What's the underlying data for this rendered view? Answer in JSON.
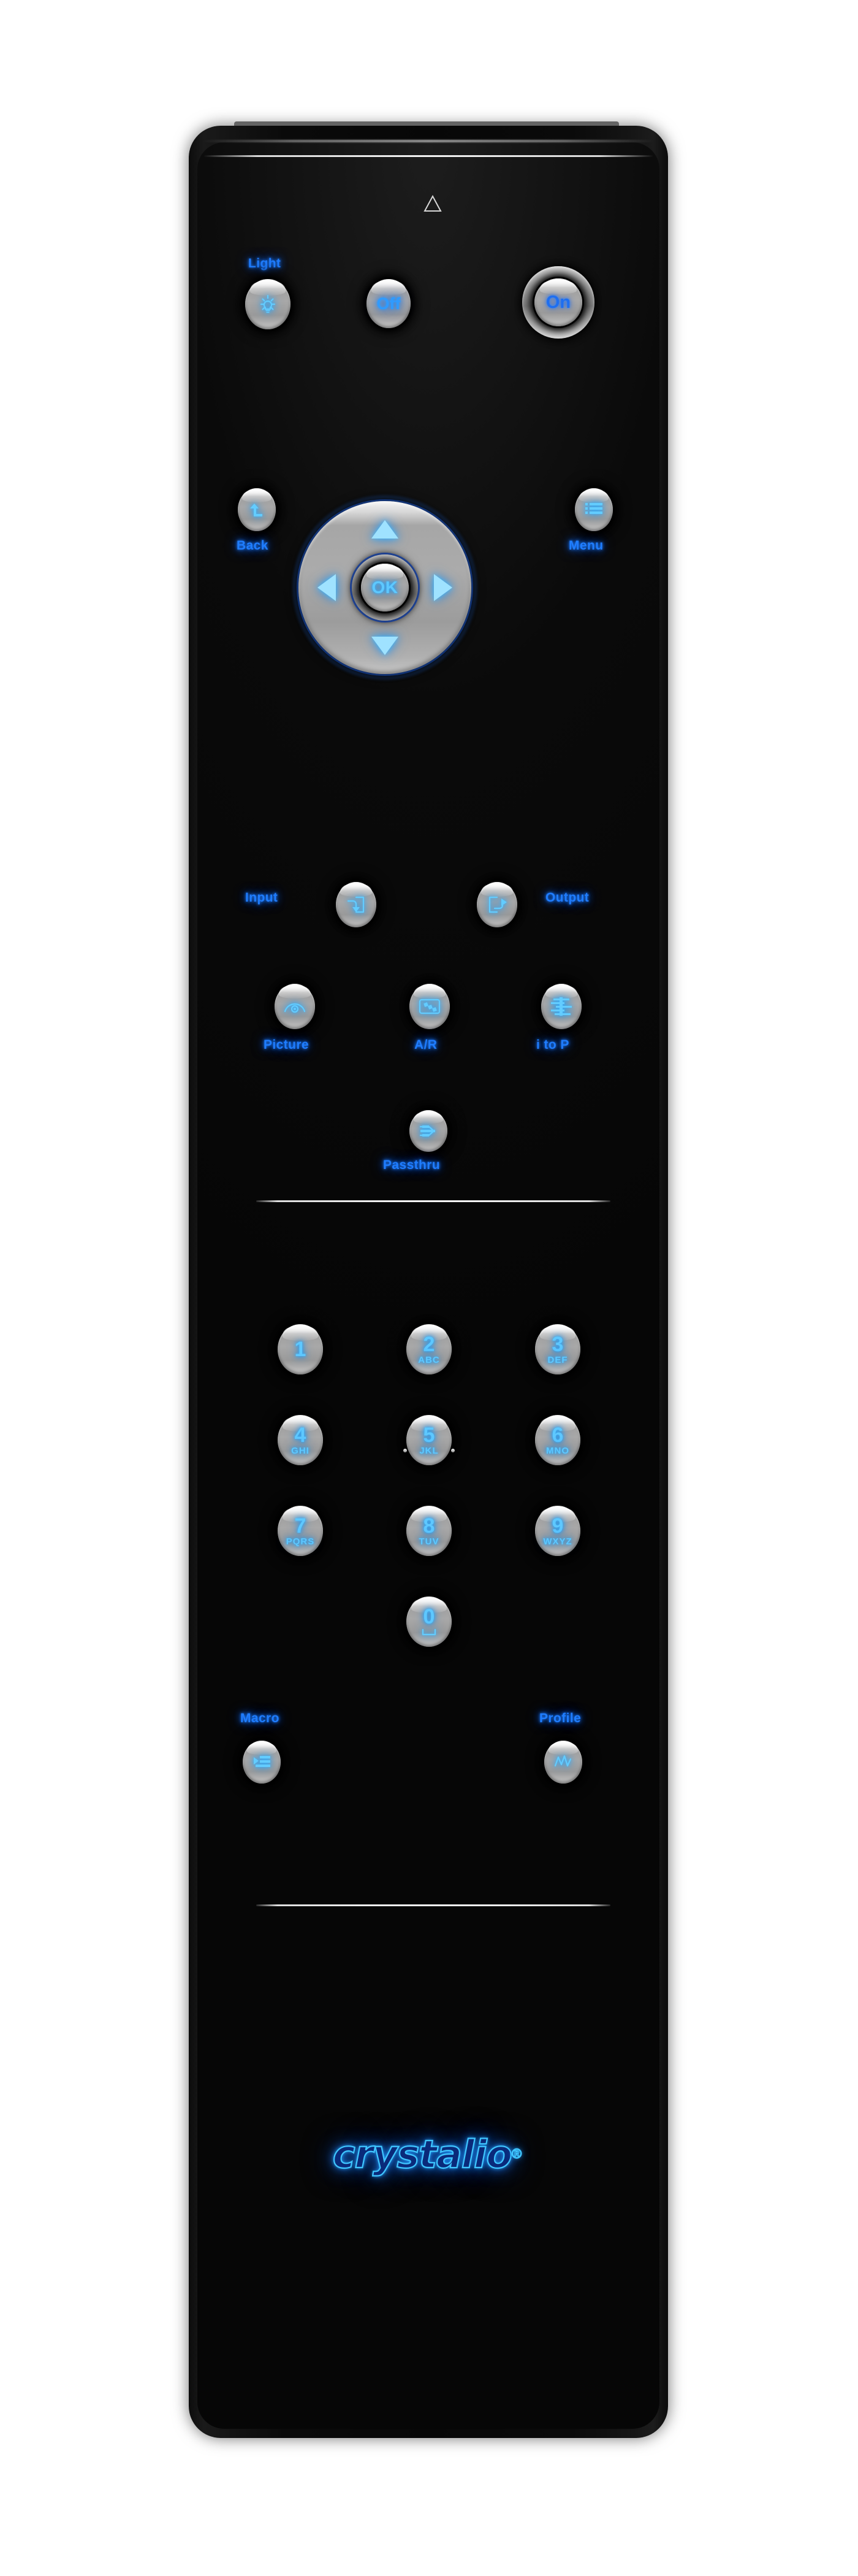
{
  "device": {
    "brand_logo": "crystalio",
    "brand_mark": "®",
    "ir_window_name": "ir-emitter-window",
    "orientation_mark": "triangle"
  },
  "power_row": {
    "light_label": "Light",
    "light_icon": "lightbulb-icon",
    "off_label": "Off",
    "on_label": "On"
  },
  "nav": {
    "back_label": "Back",
    "back_icon": "back-arrow-icon",
    "menu_label": "Menu",
    "menu_icon": "menu-list-icon",
    "ok_label": "OK",
    "up_icon": "arrow-up-icon",
    "down_icon": "arrow-down-icon",
    "left_icon": "arrow-left-icon",
    "right_icon": "arrow-right-icon"
  },
  "io_row": {
    "input_label": "Input",
    "input_icon": "input-arrow-icon",
    "output_label": "Output",
    "output_icon": "output-arrow-icon"
  },
  "function_row": {
    "picture_label": "Picture",
    "picture_icon": "eye-icon",
    "ar_label": "A/R",
    "ar_icon": "aspect-ratio-icon",
    "itop_label": "i to P",
    "itop_icon": "interlace-to-progressive-icon"
  },
  "passthru": {
    "label": "Passthru",
    "icon": "passthru-arrow-icon"
  },
  "keypad": {
    "keys": [
      {
        "digit": "1",
        "letters": ""
      },
      {
        "digit": "2",
        "letters": "ABC"
      },
      {
        "digit": "3",
        "letters": "DEF"
      },
      {
        "digit": "4",
        "letters": "GHI"
      },
      {
        "digit": "5",
        "letters": "JKL"
      },
      {
        "digit": "6",
        "letters": "MNO"
      },
      {
        "digit": "7",
        "letters": "PQRS"
      },
      {
        "digit": "8",
        "letters": "TUV"
      },
      {
        "digit": "9",
        "letters": "WXYZ"
      },
      {
        "digit": "0",
        "letters": ""
      }
    ],
    "zero_icon": "space-bar-icon"
  },
  "macro_profile": {
    "macro_label": "Macro",
    "macro_icon": "macro-icon",
    "profile_label": "Profile",
    "profile_icon": "waveform-icon"
  },
  "colors": {
    "glow_blue": "#1f7dff",
    "glyph_blue": "#5ec8ff",
    "body_black": "#0a0a0a",
    "key_silver": "#a8a8a8",
    "logo_blue": "#3fc6ff"
  }
}
